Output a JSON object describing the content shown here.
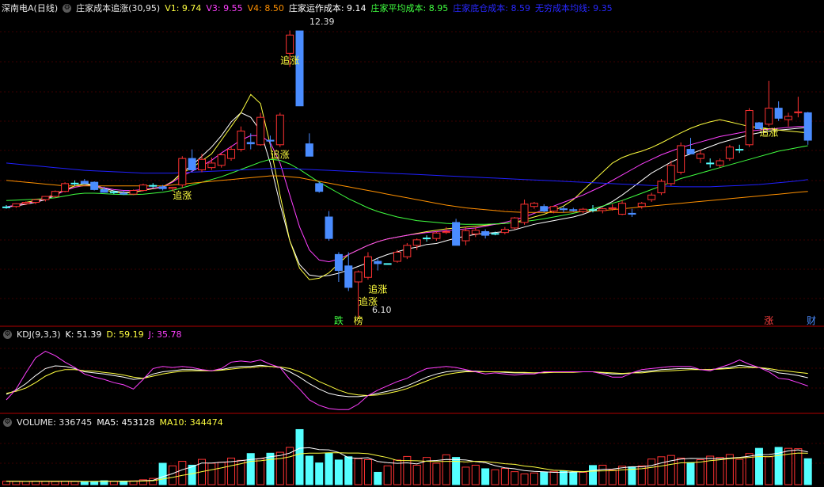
{
  "header": {
    "stock": "深南电A(日线)",
    "indicator": "庄家成本追涨(30,95)",
    "v1": "V1: 9.74",
    "v3": "V3: 9.55",
    "v4": "V4: 8.50",
    "operating_cost": "庄家运作成本: 9.14",
    "avg_cost": "庄家平均成本: 8.95",
    "bottom_cost": "庄家底仓成本: 8.59",
    "infinite_ma": "无穷成本均线: 9.35"
  },
  "kdj": {
    "title": "KDJ(9,3,3)",
    "k": "K: 51.39",
    "d": "D: 59.19",
    "j": "J: 35.78"
  },
  "volume": {
    "title": "VOLUME: 336745",
    "ma5": "MA5: 453128",
    "ma10": "MA10: 344474"
  },
  "chart_labels": {
    "high": "12.39",
    "low": "6.10",
    "signal": "追涨",
    "tags": [
      "跌",
      "榜",
      "涨",
      "财"
    ]
  },
  "colors": {
    "up": "#ff3232",
    "down": "#4a8cff",
    "flat": "#54ffff",
    "grid": "#7a0000",
    "ma_white": "#ffffff",
    "ma_yellow": "#ffff40",
    "ma_magenta": "#ff40ff",
    "ma_green": "#40ff40",
    "ma_blue": "#2020ff",
    "ma_orange": "#ff9000"
  },
  "chart_data": {
    "type": "candlestick",
    "ohlc": [
      [
        8.54,
        8.58,
        8.5,
        8.54
      ],
      [
        8.55,
        8.62,
        8.52,
        8.61
      ],
      [
        8.61,
        8.66,
        8.58,
        8.64
      ],
      [
        8.64,
        8.72,
        8.6,
        8.7
      ],
      [
        8.7,
        8.78,
        8.66,
        8.77
      ],
      [
        8.77,
        8.9,
        8.74,
        8.88
      ],
      [
        8.88,
        9.08,
        8.86,
        9.05
      ],
      [
        9.05,
        9.12,
        9.0,
        9.06
      ],
      [
        9.1,
        9.15,
        9.04,
        9.05
      ],
      [
        9.08,
        9.1,
        8.9,
        8.92
      ],
      [
        8.92,
        8.98,
        8.85,
        8.86
      ],
      [
        8.86,
        8.9,
        8.82,
        8.87
      ],
      [
        8.84,
        8.9,
        8.8,
        8.82
      ],
      [
        8.82,
        8.92,
        8.8,
        8.9
      ],
      [
        8.9,
        9.05,
        8.88,
        9.02
      ],
      [
        9.0,
        9.06,
        8.95,
        9.01
      ],
      [
        8.98,
        9.02,
        8.9,
        8.94
      ],
      [
        8.94,
        8.98,
        8.88,
        8.97
      ],
      [
        9.02,
        9.65,
        8.96,
        9.6
      ],
      [
        9.6,
        9.8,
        9.3,
        9.35
      ],
      [
        9.35,
        9.7,
        9.3,
        9.58
      ],
      [
        9.4,
        9.62,
        9.35,
        9.5
      ],
      [
        9.45,
        9.72,
        9.4,
        9.68
      ],
      [
        9.6,
        9.88,
        9.55,
        9.8
      ],
      [
        9.8,
        10.3,
        9.75,
        10.2
      ],
      [
        9.95,
        10.15,
        9.8,
        9.92
      ],
      [
        9.9,
        10.6,
        9.88,
        10.5
      ],
      [
        10.0,
        10.1,
        9.85,
        9.98
      ],
      [
        9.9,
        10.6,
        9.85,
        10.55
      ],
      [
        11.9,
        12.4,
        11.6,
        12.3
      ],
      [
        12.39,
        12.39,
        10.75,
        10.75
      ],
      [
        9.92,
        10.15,
        9.65,
        9.65
      ],
      [
        9.05,
        9.1,
        8.85,
        8.88
      ],
      [
        8.32,
        8.45,
        7.8,
        7.85
      ],
      [
        7.5,
        7.55,
        6.9,
        7.15
      ],
      [
        7.25,
        7.55,
        6.7,
        6.78
      ],
      [
        6.9,
        7.15,
        6.1,
        7.12
      ],
      [
        7.0,
        7.55,
        6.95,
        7.45
      ],
      [
        7.35,
        7.42,
        7.15,
        7.3
      ],
      [
        7.3,
        7.3,
        7.28,
        7.3
      ],
      [
        7.35,
        7.6,
        7.32,
        7.55
      ],
      [
        7.45,
        7.75,
        7.4,
        7.7
      ],
      [
        7.7,
        7.85,
        7.6,
        7.82
      ],
      [
        7.85,
        7.92,
        7.78,
        7.86
      ],
      [
        7.85,
        8.0,
        7.8,
        7.97
      ],
      [
        7.98,
        8.1,
        7.95,
        8.0
      ],
      [
        8.2,
        8.28,
        7.7,
        7.7
      ],
      [
        7.8,
        8.1,
        7.7,
        8.02
      ],
      [
        7.95,
        8.1,
        7.88,
        8.03
      ],
      [
        8.0,
        8.05,
        7.85,
        7.92
      ],
      [
        7.95,
        8.0,
        7.92,
        7.96
      ],
      [
        7.98,
        8.1,
        7.94,
        8.05
      ],
      [
        8.08,
        8.32,
        8.05,
        8.3
      ],
      [
        8.2,
        8.7,
        8.15,
        8.6
      ],
      [
        8.55,
        8.65,
        8.5,
        8.62
      ],
      [
        8.55,
        8.6,
        8.42,
        8.45
      ],
      [
        8.45,
        8.56,
        8.4,
        8.55
      ],
      [
        8.5,
        8.56,
        8.42,
        8.48
      ],
      [
        8.48,
        8.52,
        8.44,
        8.46
      ],
      [
        8.44,
        8.52,
        8.4,
        8.49
      ],
      [
        8.48,
        8.58,
        8.42,
        8.47
      ],
      [
        8.46,
        8.52,
        8.4,
        8.5
      ],
      [
        8.5,
        8.6,
        8.46,
        8.52
      ],
      [
        8.38,
        8.68,
        8.36,
        8.62
      ],
      [
        8.4,
        8.5,
        8.32,
        8.38
      ],
      [
        8.55,
        8.65,
        8.5,
        8.62
      ],
      [
        8.7,
        8.85,
        8.65,
        8.8
      ],
      [
        8.85,
        9.15,
        8.8,
        9.1
      ],
      [
        9.05,
        9.55,
        9.0,
        9.45
      ],
      [
        9.3,
        9.95,
        9.25,
        9.88
      ],
      [
        9.8,
        10.05,
        9.7,
        9.7
      ],
      [
        9.6,
        9.78,
        9.5,
        9.7
      ],
      [
        9.5,
        9.6,
        9.4,
        9.5
      ],
      [
        9.45,
        9.6,
        9.4,
        9.55
      ],
      [
        9.6,
        9.9,
        9.55,
        9.85
      ],
      [
        9.8,
        9.9,
        9.72,
        9.8
      ],
      [
        9.9,
        10.7,
        9.85,
        10.65
      ],
      [
        10.38,
        10.4,
        10.25,
        10.25
      ],
      [
        10.35,
        11.3,
        10.3,
        10.7
      ],
      [
        10.7,
        10.85,
        10.42,
        10.48
      ],
      [
        10.45,
        10.6,
        10.3,
        10.52
      ],
      [
        10.6,
        10.95,
        10.5,
        10.62
      ],
      [
        10.6,
        10.62,
        9.9,
        10.0
      ]
    ],
    "volume": [
      52000,
      50000,
      49000,
      55000,
      53000,
      47000,
      54000,
      48000,
      45000,
      50000,
      60000,
      52000,
      55000,
      58000,
      75000,
      96000,
      330000,
      290000,
      360000,
      300000,
      390000,
      330000,
      345000,
      410000,
      375000,
      480000,
      400000,
      485000,
      500000,
      575000,
      850000,
      440000,
      335000,
      485000,
      380000,
      430000,
      400000,
      385000,
      190000,
      290000,
      380000,
      435000,
      300000,
      420000,
      330000,
      460000,
      420000,
      270000,
      300000,
      245000,
      230000,
      250000,
      200000,
      165000,
      180000,
      195000,
      205000,
      210000,
      185000,
      190000,
      295000,
      300000,
      225000,
      285000,
      275000,
      290000,
      395000,
      430000,
      450000,
      410000,
      340000,
      385000,
      440000,
      420000,
      465000,
      390000,
      480000,
      560000,
      430000,
      575000,
      560000,
      555000,
      400000
    ],
    "vol_ylim": [
      0,
      880000
    ],
    "price_ylim": [
      5.93,
      12.72
    ],
    "ma": [
      {
        "color": "#ffffff",
        "values": [
          8.54,
          8.56,
          8.6,
          8.64,
          8.7,
          8.79,
          8.91,
          9.0,
          9.05,
          9.02,
          8.95,
          8.89,
          8.86,
          8.86,
          8.9,
          8.94,
          8.97,
          9.1,
          9.3,
          9.45,
          9.65,
          9.85,
          10.1,
          10.4,
          10.6,
          10.5,
          10.2,
          9.5,
          8.6,
          7.8,
          7.28,
          7.05,
          7.02,
          7.04,
          7.09,
          7.16,
          7.24,
          7.32,
          7.42,
          7.5,
          7.56,
          7.62,
          7.66,
          7.72,
          7.74,
          7.8,
          7.86,
          7.9,
          7.94,
          7.96,
          7.98,
          8.0,
          8.04,
          8.1,
          8.16,
          8.2,
          8.24,
          8.28,
          8.32,
          8.38,
          8.46,
          8.55,
          8.66,
          8.8,
          8.96,
          9.12,
          9.28,
          9.4,
          9.52,
          9.62,
          9.7,
          9.78,
          9.86,
          9.94,
          10.0,
          10.06,
          10.12,
          10.16,
          10.2,
          10.22,
          10.24,
          10.26,
          10.28
        ]
      },
      {
        "color": "#ffff40",
        "values": [
          8.54,
          8.58,
          8.64,
          8.68,
          8.74,
          8.82,
          8.92,
          9.0,
          9.04,
          9.0,
          8.92,
          8.86,
          8.84,
          8.86,
          8.9,
          8.94,
          8.98,
          9.1,
          9.28,
          9.4,
          9.55,
          9.7,
          10.0,
          10.3,
          10.6,
          11.0,
          10.8,
          9.9,
          8.8,
          7.8,
          7.2,
          6.95,
          6.98,
          7.1,
          7.3,
          7.5,
          7.6,
          7.7,
          7.78,
          7.84,
          7.88,
          7.92,
          7.96,
          8.0,
          8.03,
          8.06,
          8.08,
          8.1,
          8.12,
          8.14,
          8.16,
          8.18,
          8.2,
          8.26,
          8.32,
          8.38,
          8.46,
          8.56,
          8.7,
          8.9,
          9.1,
          9.3,
          9.5,
          9.62,
          9.7,
          9.76,
          9.84,
          9.94,
          10.05,
          10.16,
          10.26,
          10.34,
          10.4,
          10.45,
          10.4,
          10.35,
          10.3,
          10.28,
          10.25,
          10.22,
          10.2,
          10.18,
          10.16
        ]
      },
      {
        "color": "#ff40ff",
        "values": [
          8.54,
          8.58,
          8.62,
          8.66,
          8.72,
          8.8,
          8.9,
          8.97,
          9.01,
          9.0,
          8.96,
          8.92,
          8.9,
          8.9,
          8.92,
          8.95,
          8.98,
          9.08,
          9.22,
          9.32,
          9.44,
          9.56,
          9.72,
          9.86,
          10.0,
          10.1,
          10.1,
          9.95,
          9.5,
          8.8,
          8.1,
          7.6,
          7.38,
          7.34,
          7.4,
          7.5,
          7.6,
          7.7,
          7.78,
          7.84,
          7.88,
          7.92,
          7.95,
          7.98,
          8.0,
          8.02,
          8.04,
          8.06,
          8.08,
          8.12,
          8.16,
          8.2,
          8.26,
          8.32,
          8.4,
          8.48,
          8.56,
          8.64,
          8.72,
          8.8,
          8.9,
          9.0,
          9.12,
          9.24,
          9.36,
          9.48,
          9.58,
          9.68,
          9.76,
          9.84,
          9.9,
          9.96,
          10.02,
          10.08,
          10.12,
          10.16,
          10.2,
          10.22,
          10.24,
          10.26,
          10.28,
          10.3,
          10.3
        ]
      },
      {
        "color": "#40ff40",
        "values": [
          8.68,
          8.69,
          8.7,
          8.71,
          8.72,
          8.74,
          8.78,
          8.82,
          8.84,
          8.84,
          8.83,
          8.82,
          8.81,
          8.81,
          8.82,
          8.84,
          8.86,
          8.9,
          8.96,
          9.02,
          9.08,
          9.14,
          9.2,
          9.28,
          9.36,
          9.44,
          9.52,
          9.58,
          9.56,
          9.48,
          9.36,
          9.22,
          9.08,
          8.96,
          8.84,
          8.72,
          8.62,
          8.52,
          8.44,
          8.38,
          8.32,
          8.28,
          8.24,
          8.22,
          8.2,
          8.18,
          8.17,
          8.16,
          8.16,
          8.16,
          8.17,
          8.18,
          8.2,
          8.22,
          8.25,
          8.28,
          8.32,
          8.36,
          8.4,
          8.45,
          8.5,
          8.56,
          8.62,
          8.68,
          8.76,
          8.84,
          8.92,
          9.0,
          9.08,
          9.16,
          9.22,
          9.28,
          9.34,
          9.4,
          9.46,
          9.52,
          9.58,
          9.64,
          9.7,
          9.76,
          9.8,
          9.84,
          9.88
        ]
      },
      {
        "color": "#2020ff",
        "values": [
          9.5,
          9.48,
          9.46,
          9.44,
          9.42,
          9.4,
          9.38,
          9.36,
          9.34,
          9.33,
          9.32,
          9.31,
          9.3,
          9.29,
          9.28,
          9.28,
          9.28,
          9.28,
          9.29,
          9.3,
          9.31,
          9.32,
          9.33,
          9.34,
          9.35,
          9.36,
          9.37,
          9.38,
          9.38,
          9.38,
          9.37,
          9.36,
          9.35,
          9.34,
          9.33,
          9.32,
          9.31,
          9.3,
          9.29,
          9.28,
          9.27,
          9.26,
          9.25,
          9.24,
          9.23,
          9.22,
          9.21,
          9.2,
          9.19,
          9.18,
          9.17,
          9.16,
          9.15,
          9.14,
          9.13,
          9.12,
          9.11,
          9.1,
          9.09,
          9.08,
          9.07,
          9.06,
          9.05,
          9.04,
          9.03,
          9.02,
          9.01,
          9.0,
          8.99,
          8.98,
          8.98,
          8.98,
          8.98,
          8.99,
          9.0,
          9.01,
          9.02,
          9.03,
          9.05,
          9.07,
          9.09,
          9.11,
          9.14
        ]
      },
      {
        "color": "#ff9000",
        "values": [
          9.12,
          9.1,
          9.08,
          9.06,
          9.04,
          9.02,
          9.0,
          9.0,
          9.0,
          9.0,
          9.0,
          9.0,
          9.0,
          9.0,
          9.0,
          9.0,
          9.0,
          9.02,
          9.04,
          9.06,
          9.08,
          9.1,
          9.12,
          9.14,
          9.16,
          9.18,
          9.2,
          9.22,
          9.22,
          9.2,
          9.18,
          9.14,
          9.1,
          9.06,
          9.02,
          8.98,
          8.94,
          8.9,
          8.86,
          8.82,
          8.78,
          8.74,
          8.7,
          8.66,
          8.62,
          8.58,
          8.55,
          8.52,
          8.5,
          8.48,
          8.46,
          8.44,
          8.43,
          8.42,
          8.42,
          8.42,
          8.42,
          8.42,
          8.43,
          8.44,
          8.45,
          8.46,
          8.48,
          8.5,
          8.52,
          8.54,
          8.56,
          8.58,
          8.6,
          8.62,
          8.64,
          8.66,
          8.68,
          8.7,
          8.72,
          8.74,
          8.76,
          8.78,
          8.8,
          8.82,
          8.84,
          8.86,
          8.88
        ]
      }
    ],
    "kdj": {
      "ylim": [
        -15,
        120
      ],
      "k": [
        20,
        28,
        40,
        55,
        68,
        73,
        72,
        68,
        62,
        60,
        58,
        55,
        52,
        48,
        50,
        58,
        62,
        64,
        66,
        66,
        65,
        64,
        66,
        70,
        72,
        72,
        74,
        72,
        70,
        62,
        52,
        40,
        30,
        22,
        18,
        16,
        16,
        18,
        22,
        26,
        30,
        36,
        44,
        52,
        58,
        62,
        64,
        64,
        63,
        62,
        62,
        61,
        60,
        60,
        60,
        61,
        62,
        62,
        62,
        62,
        62,
        60,
        58,
        58,
        60,
        62,
        64,
        66,
        67,
        68,
        68,
        66,
        66,
        68,
        70,
        74,
        72,
        70,
        66,
        60,
        58,
        55,
        51
      ],
      "d": [
        22,
        26,
        32,
        42,
        54,
        62,
        66,
        66,
        64,
        63,
        61,
        59,
        56,
        52,
        50,
        54,
        58,
        61,
        63,
        64,
        64,
        64,
        65,
        67,
        69,
        70,
        72,
        72,
        71,
        68,
        62,
        54,
        44,
        36,
        28,
        22,
        19,
        18,
        19,
        22,
        26,
        31,
        38,
        45,
        52,
        57,
        60,
        62,
        62,
        62,
        62,
        62,
        61,
        61,
        60,
        60,
        61,
        61,
        61,
        62,
        62,
        61,
        60,
        59,
        60,
        60,
        62,
        63,
        64,
        65,
        66,
        66,
        66,
        67,
        68,
        70,
        70,
        70,
        68,
        65,
        63,
        61,
        59
      ],
      "j": [
        10,
        30,
        60,
        88,
        100,
        92,
        80,
        70,
        58,
        52,
        48,
        42,
        38,
        30,
        48,
        68,
        72,
        70,
        72,
        70,
        66,
        64,
        68,
        80,
        82,
        80,
        84,
        76,
        70,
        48,
        30,
        10,
        0,
        -6,
        -8,
        -8,
        2,
        18,
        28,
        36,
        44,
        50,
        60,
        68,
        70,
        72,
        70,
        66,
        62,
        58,
        60,
        58,
        56,
        58,
        58,
        62,
        62,
        62,
        62,
        62,
        62,
        58,
        52,
        52,
        60,
        66,
        68,
        70,
        72,
        72,
        72,
        66,
        64,
        70,
        76,
        84,
        76,
        70,
        62,
        50,
        48,
        42,
        35.78
      ]
    }
  }
}
